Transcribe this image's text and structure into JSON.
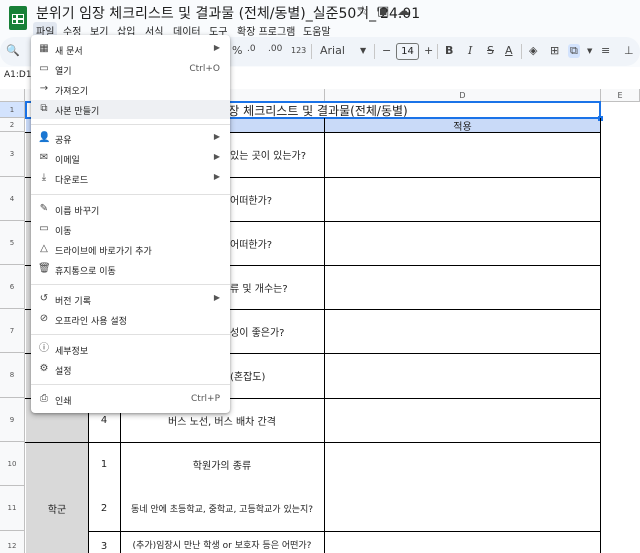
{
  "doc": {
    "title": "분위기 임장 체크리스트 및 결과물 (전체/동별)_실준50기_'24.01"
  },
  "title_icons": [
    "star-icon",
    "move-to-folder-icon",
    "cloud-status-icon"
  ],
  "menu": [
    "파일",
    "수정",
    "보기",
    "삽입",
    "서식",
    "데이터",
    "도구",
    "확장 프로그램",
    "도움말"
  ],
  "toolbar": {
    "font_name": "Arial",
    "font_size": "14",
    "percent": "%",
    "decimals": ".0",
    "more_decimals": ".00",
    "number_format": "123",
    "minus": "−",
    "plus": "+"
  },
  "name_box": "A1:D1",
  "file_menu": {
    "items": [
      {
        "label": "새 문서",
        "icon": "new-sheet-icon",
        "submenu": true
      },
      {
        "label": "열기",
        "icon": "open-folder-icon",
        "shortcut": "Ctrl+O"
      },
      {
        "label": "가져오기",
        "icon": "import-icon"
      },
      {
        "label": "사본 만들기",
        "icon": "copy-icon"
      },
      {
        "label": "공유",
        "icon": "share-icon",
        "submenu": true
      },
      {
        "label": "이메일",
        "icon": "email-icon",
        "submenu": true
      },
      {
        "label": "다운로드",
        "icon": "download-icon",
        "submenu": true
      },
      {
        "label": "이름 바꾸기",
        "icon": "rename-icon"
      },
      {
        "label": "이동",
        "icon": "move-icon"
      },
      {
        "label": "드라이브에 바로가기 추가",
        "icon": "drive-shortcut-icon"
      },
      {
        "label": "휴지통으로 이동",
        "icon": "trash-icon"
      },
      {
        "label": "버전 기록",
        "icon": "history-icon",
        "submenu": true
      },
      {
        "label": "오프라인 사용 설정",
        "icon": "offline-icon"
      },
      {
        "label": "세부정보",
        "icon": "info-icon"
      },
      {
        "label": "설정",
        "icon": "settings-icon"
      },
      {
        "label": "인쇄",
        "icon": "print-icon",
        "shortcut": "Ctrl+P"
      }
    ]
  },
  "sheet": {
    "col_headers": [
      "D",
      "E"
    ],
    "row_headers": [
      "1",
      "2",
      "3",
      "4",
      "5",
      "6",
      "7",
      "8",
      "9",
      "10",
      "11",
      "12"
    ],
    "title_cell": "임장 체크리스트 및 결과물(전체/동별)",
    "header_cell": "적용",
    "cells": {
      "r3": "있는 곳이 있는가?",
      "r4": "어떠한가?",
      "r5": "어떠한가?",
      "r6": "류 및 개수는?",
      "r7": "성이 좋은가?",
      "r8": "(혼잡도)",
      "r9_num": "4",
      "r9": "버스 노선, 버스 배차 간격",
      "r10_num": "1",
      "r10": "학원가의 종류",
      "r11_cat": "학군",
      "r11_num": "2",
      "r11": "동네 안에 초등학교, 중학교, 고등학교가 있는지?",
      "r12_num": "3",
      "r12": "(추가)임장시 만난 학생 or 보호자 등은 어떤가?"
    }
  },
  "colors": {
    "header_blue": "#c9daf8",
    "selection": "#1a73e8",
    "category_gray": "#d9d9d9"
  }
}
